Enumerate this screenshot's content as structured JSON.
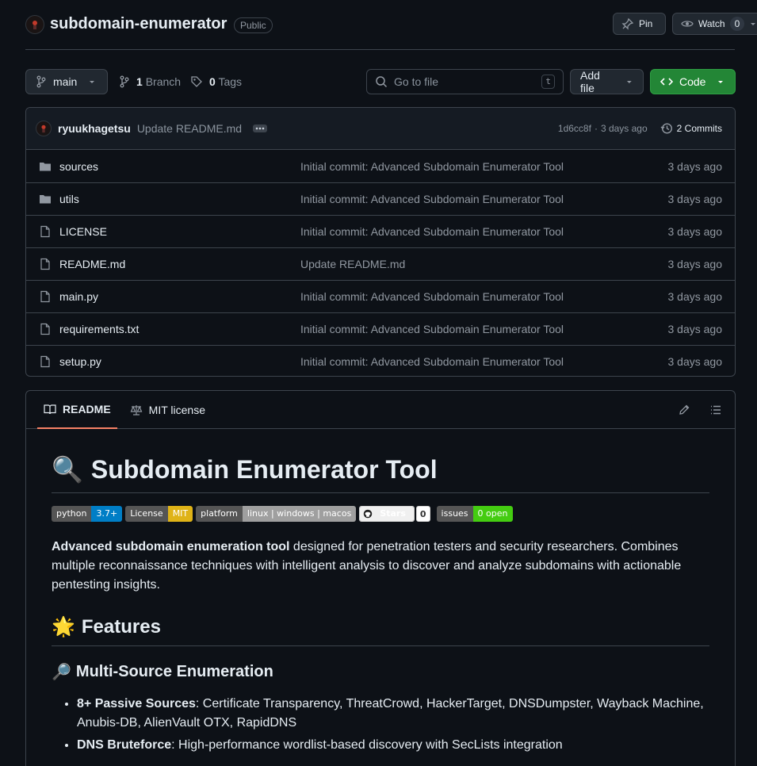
{
  "repo": {
    "name": "subdomain-enumerator",
    "visibility": "Public",
    "pin_label": "Pin",
    "watch_label": "Watch",
    "watch_count": "0"
  },
  "toolbar": {
    "branch": "main",
    "branch_count": "1",
    "branch_label": "Branch",
    "tag_count": "0",
    "tag_label": "Tags",
    "search_placeholder": "Go to file",
    "search_shortcut": "t",
    "add_file_label": "Add file",
    "code_label": "Code"
  },
  "latest_commit": {
    "author": "ryuukhagetsu",
    "message": "Update README.md",
    "hash": "1d6cc8f",
    "time": "3 days ago",
    "commits_label": "2 Commits"
  },
  "files": [
    {
      "name": "sources",
      "type": "folder",
      "message": "Initial commit: Advanced Subdomain Enumerator Tool",
      "date": "3 days ago"
    },
    {
      "name": "utils",
      "type": "folder",
      "message": "Initial commit: Advanced Subdomain Enumerator Tool",
      "date": "3 days ago"
    },
    {
      "name": "LICENSE",
      "type": "file",
      "message": "Initial commit: Advanced Subdomain Enumerator Tool",
      "date": "3 days ago"
    },
    {
      "name": "README.md",
      "type": "file",
      "message": "Update README.md",
      "date": "3 days ago"
    },
    {
      "name": "main.py",
      "type": "file",
      "message": "Initial commit: Advanced Subdomain Enumerator Tool",
      "date": "3 days ago"
    },
    {
      "name": "requirements.txt",
      "type": "file",
      "message": "Initial commit: Advanced Subdomain Enumerator Tool",
      "date": "3 days ago"
    },
    {
      "name": "setup.py",
      "type": "file",
      "message": "Initial commit: Advanced Subdomain Enumerator Tool",
      "date": "3 days ago"
    }
  ],
  "readme": {
    "tab_readme": "README",
    "tab_license": "MIT license",
    "title": "Subdomain Enumerator Tool",
    "title_emoji": "🔍",
    "badges": {
      "python_l": "python",
      "python_r": "3.7+",
      "license_l": "License",
      "license_r": "MIT",
      "platform_l": "platform",
      "platform_r": "linux | windows | macos",
      "stars_l": "Stars",
      "stars_r": "0",
      "issues_l": "issues",
      "issues_r": "0 open"
    },
    "intro_bold": "Advanced subdomain enumeration tool",
    "intro_rest": " designed for penetration testers and security researchers. Combines multiple reconnaissance techniques with intelligent analysis to discover and analyze subdomains with actionable pentesting insights.",
    "features_emoji": "🌟",
    "features_heading": "Features",
    "multi_emoji": "🔎",
    "multi_heading": "Multi-Source Enumeration",
    "bullets": [
      {
        "bold": "8+ Passive Sources",
        "rest": ": Certificate Transparency, ThreatCrowd, HackerTarget, DNSDumpster, Wayback Machine, Anubis-DB, AlienVault OTX, RapidDNS"
      },
      {
        "bold": "DNS Bruteforce",
        "rest": ": High-performance wordlist-based discovery with SecLists integration"
      }
    ]
  },
  "colors": {
    "background": "#0d1117",
    "border": "#3d444d",
    "green_button": "#238636",
    "tab_underline": "#f78166"
  }
}
